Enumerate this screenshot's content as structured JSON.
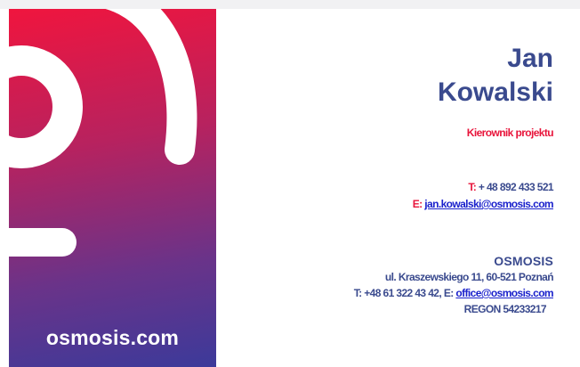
{
  "card": {
    "domain": "osmosis.com",
    "first_name": "Jan",
    "last_name": "Kowalski",
    "role": "Kierownik projektu",
    "phone_tag": "T:",
    "phone": "+ 48 892 433 521",
    "email_tag": "E:",
    "email": "jan.kowalski@osmosis.com",
    "company": "OSMOSIS",
    "street": "ul. Kraszewskiego 11, 60-521 Poznań",
    "office_phone_prefix": "T: +48 61 322 43 42, E:",
    "office_email": "office@osmosis.com",
    "regon": "REGON 54233217"
  },
  "colors": {
    "navy": "#3a4a8e",
    "accent_red": "#e8153b",
    "link_blue": "#1a21cc",
    "gradient_top": "#f0153e",
    "gradient_bottom": "#3c3a9a"
  },
  "icons": {
    "logo": "osmosis-logo-mark"
  }
}
